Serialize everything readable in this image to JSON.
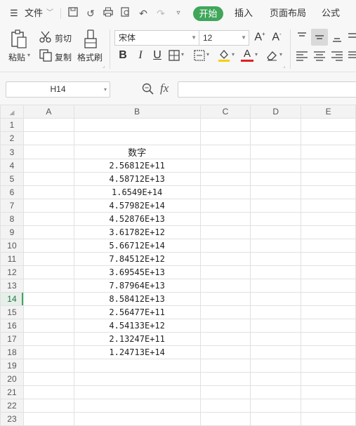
{
  "menubar": {
    "file_label": "文件",
    "tabs": [
      {
        "label": "开始",
        "active": true
      },
      {
        "label": "插入",
        "active": false
      },
      {
        "label": "页面布局",
        "active": false
      },
      {
        "label": "公式",
        "active": false
      }
    ]
  },
  "clipboard": {
    "paste_label": "粘贴",
    "cut_label": "剪切",
    "copy_label": "复制",
    "format_painter_label": "格式刷"
  },
  "font": {
    "family": "宋体",
    "size": "12",
    "font_color": "#e02020",
    "fill_color": "#f5d000"
  },
  "formula_bar": {
    "name_box": "H14",
    "fx_label": "fx",
    "formula_value": ""
  },
  "sheet": {
    "columns": [
      "A",
      "B",
      "C",
      "D",
      "E"
    ],
    "active_row": "14",
    "rows": [
      {
        "num": "1",
        "b": ""
      },
      {
        "num": "2",
        "b": ""
      },
      {
        "num": "3",
        "b": "数字"
      },
      {
        "num": "4",
        "b": "2.56812E+11"
      },
      {
        "num": "5",
        "b": "4.58712E+13"
      },
      {
        "num": "6",
        "b": "1.6549E+14"
      },
      {
        "num": "7",
        "b": "4.57982E+14"
      },
      {
        "num": "8",
        "b": "4.52876E+13"
      },
      {
        "num": "9",
        "b": "3.61782E+12"
      },
      {
        "num": "10",
        "b": "5.66712E+14"
      },
      {
        "num": "11",
        "b": "7.84512E+12"
      },
      {
        "num": "12",
        "b": "3.69545E+13"
      },
      {
        "num": "13",
        "b": "7.87964E+13"
      },
      {
        "num": "14",
        "b": "8.58412E+13"
      },
      {
        "num": "15",
        "b": "2.56477E+11"
      },
      {
        "num": "16",
        "b": "4.54133E+12"
      },
      {
        "num": "17",
        "b": "2.13247E+11"
      },
      {
        "num": "18",
        "b": "1.24713E+14"
      },
      {
        "num": "19",
        "b": ""
      },
      {
        "num": "20",
        "b": ""
      },
      {
        "num": "21",
        "b": ""
      },
      {
        "num": "22",
        "b": ""
      },
      {
        "num": "23",
        "b": ""
      }
    ]
  }
}
